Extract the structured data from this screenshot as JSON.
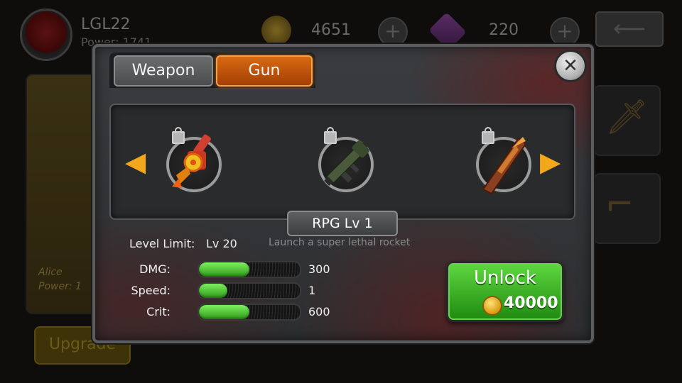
{
  "hud": {
    "player_name": "LGL22",
    "power_text": "Power: 1741",
    "coins": "4651",
    "gems": "220",
    "back_icon": "back-arrow-icon",
    "coin_icon": "coin-icon",
    "gem_icon": "gem-icon"
  },
  "character": {
    "name_line": "Alice",
    "power_line": "Power: 1"
  },
  "upgrade_label": "Upgrade",
  "popup": {
    "tabs": [
      {
        "label": "Weapon",
        "active": false
      },
      {
        "label": "Gun",
        "active": true
      }
    ],
    "close_icon": "close-icon",
    "weapons": [
      {
        "icon": "flamethrower-weapon-icon",
        "locked": true
      },
      {
        "icon": "rpg-launcher-weapon-icon",
        "locked": true
      },
      {
        "icon": "fire-blade-weapon-icon",
        "locked": true
      }
    ],
    "selected_name": "RPG Lv 1",
    "level_limit_label": "Level Limit:",
    "level_limit_value": "Lv 20",
    "description": "Launch a super lethal rocket",
    "stats": [
      {
        "label": "DMG:",
        "value": "300",
        "fill": 0.5
      },
      {
        "label": "Speed:",
        "value": "1",
        "fill": 0.28
      },
      {
        "label": "Crit:",
        "value": "600",
        "fill": 0.5
      }
    ],
    "unlock": {
      "label": "Unlock",
      "price": "40000"
    }
  },
  "colors": {
    "accent_orange": "#d76a12",
    "unlock_green": "#3fbf28",
    "stat_green": "#5ed840"
  }
}
